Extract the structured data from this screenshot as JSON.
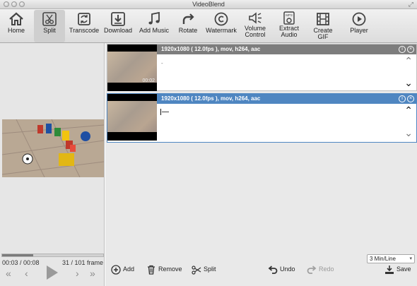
{
  "window": {
    "title": "VideoBlend"
  },
  "toolbar": {
    "items": [
      {
        "label": "Home",
        "icon": "home-icon"
      },
      {
        "label": "Split",
        "icon": "split-icon",
        "active": true
      },
      {
        "label": "Transcode",
        "icon": "transcode-icon"
      },
      {
        "label": "Download",
        "icon": "download-icon"
      },
      {
        "label": "Add Music",
        "icon": "music-icon"
      },
      {
        "label": "Rotate",
        "icon": "rotate-icon"
      },
      {
        "label": "Watermark",
        "icon": "copyright-icon"
      },
      {
        "label": "Volume Control",
        "label_line1": "Volume",
        "label_line2": "Control",
        "icon": "volume-icon"
      },
      {
        "label": "Extract Audio",
        "label_line1": "Extract",
        "label_line2": "Audio",
        "icon": "mp3-icon",
        "icon_text": "MP3"
      },
      {
        "label": "Create GIF",
        "icon": "film-icon"
      },
      {
        "label": "Player",
        "icon": "play-circle-icon"
      }
    ]
  },
  "preview": {
    "time": "00:03 / 00:08",
    "frames": "31 / 101 frame",
    "progress": 0.31
  },
  "clips": [
    {
      "info": "1920x1080 ( 12.0fps ), mov, h264, aac",
      "thumb_time": "00:02",
      "state": "normal"
    },
    {
      "info": "1920x1080 ( 12.0fps ), mov, h264, aac",
      "state": "selected"
    }
  ],
  "bottom": {
    "add": "Add",
    "remove": "Remove",
    "split": "Split",
    "undo": "Undo",
    "redo": "Redo",
    "save": "Save",
    "scale": "3 Min/Line"
  },
  "colors": {
    "selected_header": "#4f86c1",
    "normal_header": "#7d7d7d"
  }
}
